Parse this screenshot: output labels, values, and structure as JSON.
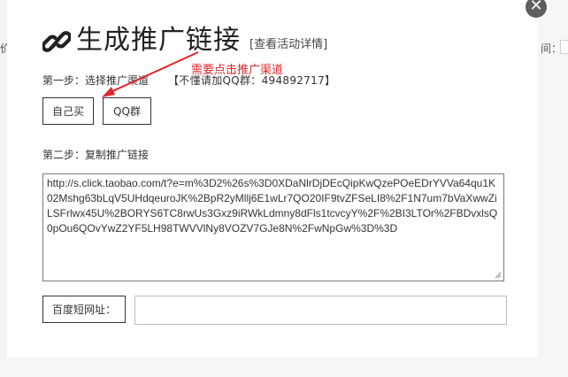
{
  "background": {
    "left_stub": "价",
    "right_label": "间："
  },
  "modal": {
    "close_glyph": "✕",
    "title": "生成推广链接",
    "title_link": "[查看活动详情]",
    "step1_label": "第一步：选择推广渠道",
    "qq_note": "【不懂请加QQ群：494892717】",
    "channel_buttons": [
      "自己买",
      "QQ群"
    ],
    "annotation": "需要点击推广渠道",
    "step2_label": "第二步：复制推广链接",
    "url_text": "http://s.click.taobao.com/t?e=m%3D2%26s%3D0XDaNlrDjDEcQipKwQzePOeEDrYVVa64qu1K02Mshg63bLqV5UHdqeuroJK%2BpR2yMllj6E1wLr7QO20IF9tvZFSeLI8%2F1N7um7bVaXwwZiLSFrlwx45U%2BORYS6TC8rwUs3Gxz9iRWkLdmny8dFls1tcvcyY%2F%2BI3LTOr%2FBDvxlsQ0pOu6QOvYwZ2YF5LH98TWVVlNy8VOZV7GJe8N%2FwNpGw%3D%3D",
    "short_url_label": "百度短网址：",
    "short_url_value": ""
  },
  "colors": {
    "annotation": "#e0262a",
    "overlay": "#b9b9b9",
    "close_button": "#5e5e5e"
  },
  "icons": {
    "title_icon": "link-icon",
    "close_icon": "close-icon"
  }
}
